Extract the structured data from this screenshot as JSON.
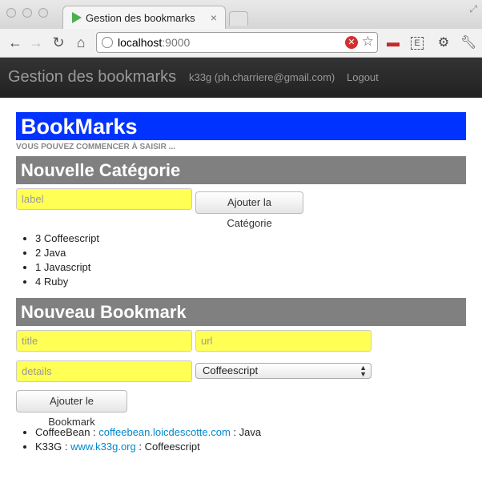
{
  "browser": {
    "tab_title": "Gestion des bookmarks",
    "tab_close": "×",
    "url_host": "localhost",
    "url_port": ":9000",
    "icons": [
      "back-arrow-icon",
      "forward-arrow-icon",
      "reload-icon",
      "home-icon",
      "globe-icon",
      "stop-icon",
      "star-icon",
      "extension-icon",
      "evernote-icon",
      "gear-icon",
      "wrench-icon"
    ]
  },
  "navbar": {
    "brand": "Gestion des bookmarks",
    "user": "k33g (ph.charriere@gmail.com)",
    "logout": "Logout"
  },
  "page": {
    "title": "BookMarks",
    "subtitle": "VOUS POUVEZ COMMENCER À SAISIR ...",
    "category_section": "Nouvelle Catégorie",
    "category_placeholder": "label",
    "add_category": "Ajouter la Catégorie",
    "categories": [
      "3 Coffeescript",
      "2 Java",
      "1 Javascript",
      "4 Ruby"
    ],
    "bookmark_section": "Nouveau Bookmark",
    "title_placeholder": "title",
    "url_placeholder": "url",
    "details_placeholder": "details",
    "selected_category": "Coffeescript",
    "add_bookmark": "Ajouter le Bookmark",
    "bookmarks": [
      {
        "name": "CoffeeBean",
        "sep": " : ",
        "link": "coffeebean.loicdescotte.com",
        "sep2": " : ",
        "category": "Java"
      },
      {
        "name": "K33G",
        "sep": " : ",
        "link": "www.k33g.org",
        "sep2": " : ",
        "category": "Coffeescript"
      }
    ]
  },
  "colors": {
    "hero": "#0033ff",
    "section": "#808080",
    "input": "#ffff55",
    "navbar": "#222222",
    "link": "#0088cc"
  }
}
